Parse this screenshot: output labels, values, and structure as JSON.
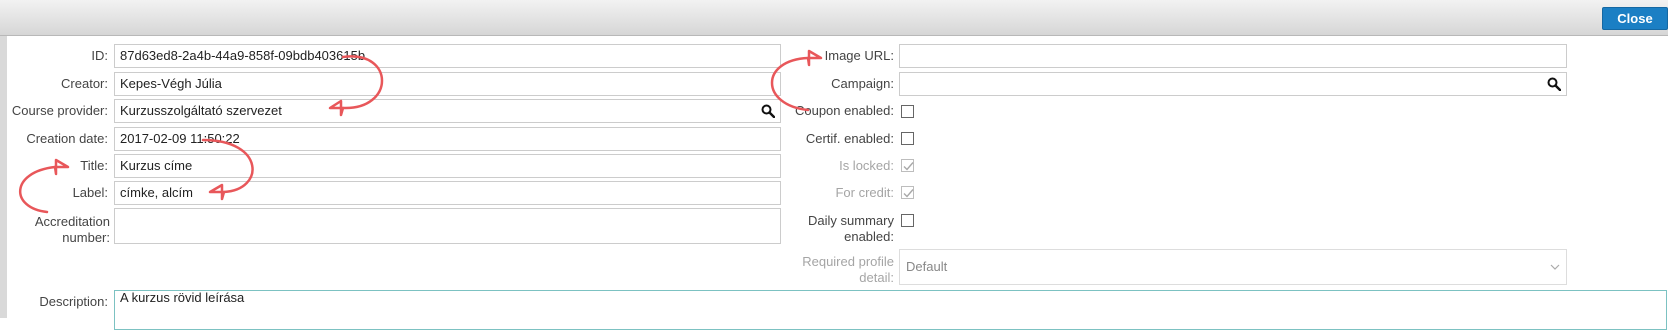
{
  "header": {
    "close_label": "Close"
  },
  "left": {
    "id": {
      "label": "ID:",
      "value": "87d63ed8-2a4b-44a9-858f-09bdb403615b"
    },
    "creator": {
      "label": "Creator:",
      "value": "Kepes-Végh Júlia"
    },
    "provider": {
      "label": "Course provider:",
      "value": "Kurzusszolgáltató szervezet"
    },
    "created": {
      "label": "Creation date:",
      "value": "2017-02-09 11:50:22"
    },
    "title": {
      "label": "Title:",
      "value": "Kurzus címe"
    },
    "tag": {
      "label": "Label:",
      "value": "címke, alcím"
    },
    "accr": {
      "label_line1": "Accreditation",
      "label_line2": "number:",
      "value": ""
    },
    "description": {
      "label": "Description:",
      "value": "A kurzus rövid leírása"
    }
  },
  "right": {
    "image_url": {
      "label": "Image URL:",
      "value": ""
    },
    "campaign": {
      "label": "Campaign:",
      "value": ""
    },
    "coupon": {
      "label": "Coupon enabled:",
      "checked": false,
      "disabled": false
    },
    "certif": {
      "label": "Certif. enabled:",
      "checked": false,
      "disabled": false
    },
    "locked": {
      "label": "Is locked:",
      "checked": true,
      "disabled": true
    },
    "credit": {
      "label": "For credit:",
      "checked": true,
      "disabled": true
    },
    "daily": {
      "label_line1": "Daily summary",
      "label_line2": "enabled:",
      "checked": false,
      "disabled": false
    },
    "profile": {
      "label_line1": "Required profile",
      "label_line2": "detail:",
      "selected": "Default"
    }
  },
  "icons": {
    "search": "magnifier-icon",
    "check": "checkmark-icon",
    "dropdown": "chevron-down-icon"
  },
  "colors": {
    "accent": "#1b7fc4",
    "annotation_arrow": "#e8575a",
    "focus_border": "#7cc2c2"
  }
}
